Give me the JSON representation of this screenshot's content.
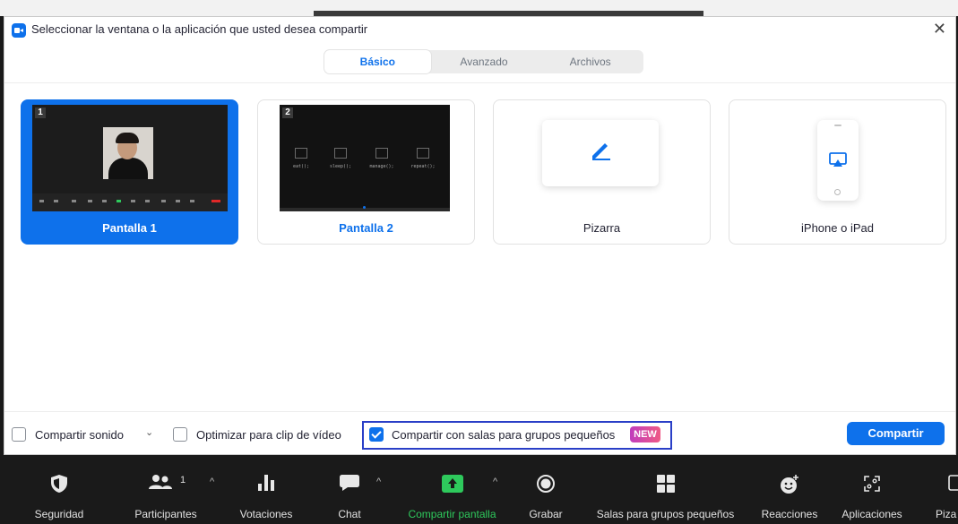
{
  "dialog": {
    "title": "Seleccionar la ventana o la aplicación que usted desea compartir",
    "close_glyph": "✕",
    "tabs": [
      {
        "label": "Básico",
        "active": true
      },
      {
        "label": "Avanzado",
        "active": false
      },
      {
        "label": "Archivos",
        "active": false
      }
    ],
    "cards": [
      {
        "label": "Pantalla 1",
        "number": "1",
        "selected": true
      },
      {
        "label": "Pantalla 2",
        "number": "2",
        "selected": false
      },
      {
        "label": "Pizarra",
        "selected": false
      },
      {
        "label": "iPhone o iPad",
        "selected": false
      }
    ],
    "screen2_code": [
      {
        "fn": "eat",
        "text": "eat();"
      },
      {
        "fn": "sleep",
        "text": "sleep();"
      },
      {
        "fn": "manage",
        "text": "manage();"
      },
      {
        "fn": "repeat",
        "text": "repeat();"
      }
    ],
    "options": {
      "share_sound": {
        "label": "Compartir sonido",
        "checked": false
      },
      "optimize_video": {
        "label": "Optimizar para clip de vídeo",
        "checked": false
      },
      "share_breakout": {
        "label": "Compartir con salas para grupos pequeños",
        "checked": true,
        "badge": "NEW"
      }
    },
    "share_button": "Compartir"
  },
  "meeting_bar": {
    "items": [
      {
        "label": "Seguridad",
        "icon": "shield-icon"
      },
      {
        "label": "Participantes",
        "icon": "participants-icon",
        "count": "1"
      },
      {
        "label": "Votaciones",
        "icon": "polls-icon"
      },
      {
        "label": "Chat",
        "icon": "chat-icon"
      },
      {
        "label": "Compartir pantalla",
        "icon": "share-screen-icon",
        "active_color": "#2ec95c"
      },
      {
        "label": "Grabar",
        "icon": "record-icon"
      },
      {
        "label": "Salas para grupos pequeños",
        "icon": "breakout-rooms-icon"
      },
      {
        "label": "Reacciones",
        "icon": "reactions-icon"
      },
      {
        "label": "Aplicaciones",
        "icon": "apps-icon"
      },
      {
        "label": "Piza",
        "icon": "whiteboard-icon"
      }
    ]
  },
  "colors": {
    "accent": "#0e71eb",
    "green": "#2ec95c",
    "badge": "#d94a9f"
  }
}
